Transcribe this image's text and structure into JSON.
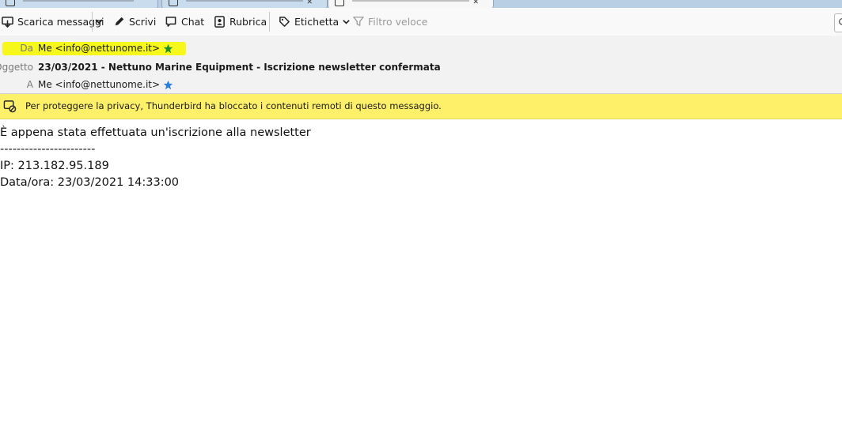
{
  "toolbar": {
    "get_messages": "Scarica messaggi",
    "write": "Scrivi",
    "chat": "Chat",
    "address_book": "Rubrica",
    "tag": "Etichetta",
    "quick_filter": "Filtro veloce"
  },
  "headers": {
    "from_label": "Da",
    "from_value": "Me <info@nettunome.it>",
    "subject_label": "Oggetto",
    "subject_value": "23/03/2021 - Nettuno Marine Equipment - Iscrizione newsletter confermata",
    "to_label": "A",
    "to_value": "Me <info@nettunome.it>"
  },
  "notification": {
    "text": "Per proteggere la privacy, Thunderbird ha bloccato i contenuti remoti di questo messaggio."
  },
  "body": {
    "lines": [
      "È appena stata effettuata un'iscrizione alla newsletter",
      "-----------------------",
      "IP: 213.182.95.189",
      "Data/ora: 23/03/2021 14:33:00"
    ]
  },
  "colors": {
    "highlight": "#f6f81c",
    "notification_bg": "#fff06a",
    "from_star": "#1f8f2a",
    "to_star": "#2a7ee0"
  }
}
